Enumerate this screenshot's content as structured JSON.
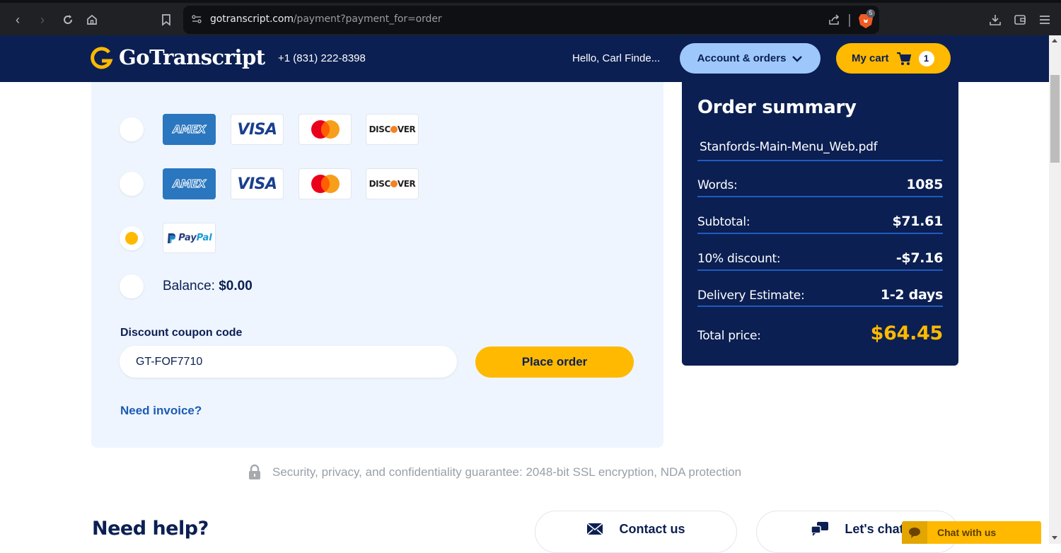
{
  "browser": {
    "url_host": "gotranscript.com",
    "url_path": "/payment?payment_for=order",
    "shields_badge": "5",
    "icons": [
      "back-icon",
      "forward-icon",
      "reload-icon",
      "home-icon",
      "bookmark-icon",
      "site-info-icon",
      "share-icon",
      "brave-shields-icon",
      "download-icon",
      "wallet-icon",
      "menu-icon"
    ]
  },
  "header": {
    "logo_text": "GoTranscript",
    "phone": "+1 (831) 222-8398",
    "greeting": "Hello, Carl Finde...",
    "account_label": "Account & orders",
    "cart_label": "My cart",
    "cart_count": "1",
    "colors": {
      "navy": "#0b1f52",
      "accent_yellow": "#ffb900",
      "account_blue": "#9ec8fb"
    }
  },
  "payment": {
    "methods": [
      {
        "id": "card-1",
        "cards": [
          "AMEX",
          "VISA",
          "MASTERCARD",
          "DISCOVER"
        ],
        "selected": false
      },
      {
        "id": "card-2",
        "cards": [
          "AMEX",
          "VISA",
          "MASTERCARD",
          "DISCOVER"
        ],
        "selected": false
      },
      {
        "id": "paypal",
        "label_pay": "Pay",
        "label_pal": "Pal",
        "selected": true
      },
      {
        "id": "balance",
        "label": "Balance:",
        "amount": "$0.00",
        "selected": false
      }
    ],
    "card_labels": {
      "amex": "AMEX",
      "visa": "VISA",
      "discover_a": "DISC",
      "discover_b": "VER"
    },
    "coupon_label": "Discount coupon code",
    "coupon_value": "GT-FOF7710",
    "place_order_label": "Place order",
    "invoice_link": "Need invoice?"
  },
  "summary": {
    "title": "Order summary",
    "file_name": "Stanfords-Main-Menu_Web.pdf",
    "rows": [
      {
        "label": "Words:",
        "value": "1085"
      },
      {
        "label": "Subtotal:",
        "value": "$71.61"
      },
      {
        "label": "10% discount:",
        "value": "-$7.16"
      },
      {
        "label": "Delivery Estimate:",
        "value": "1-2 days"
      }
    ],
    "total_label": "Total price:",
    "total_value": "$64.45"
  },
  "security_text": "Security, privacy, and confidentiality guarantee: 2048-bit SSL encryption, NDA protection",
  "help": {
    "title": "Need help?",
    "contact_label": "Contact us",
    "chat_label": "Let's chat",
    "chat_widget_label": "Chat with us"
  }
}
